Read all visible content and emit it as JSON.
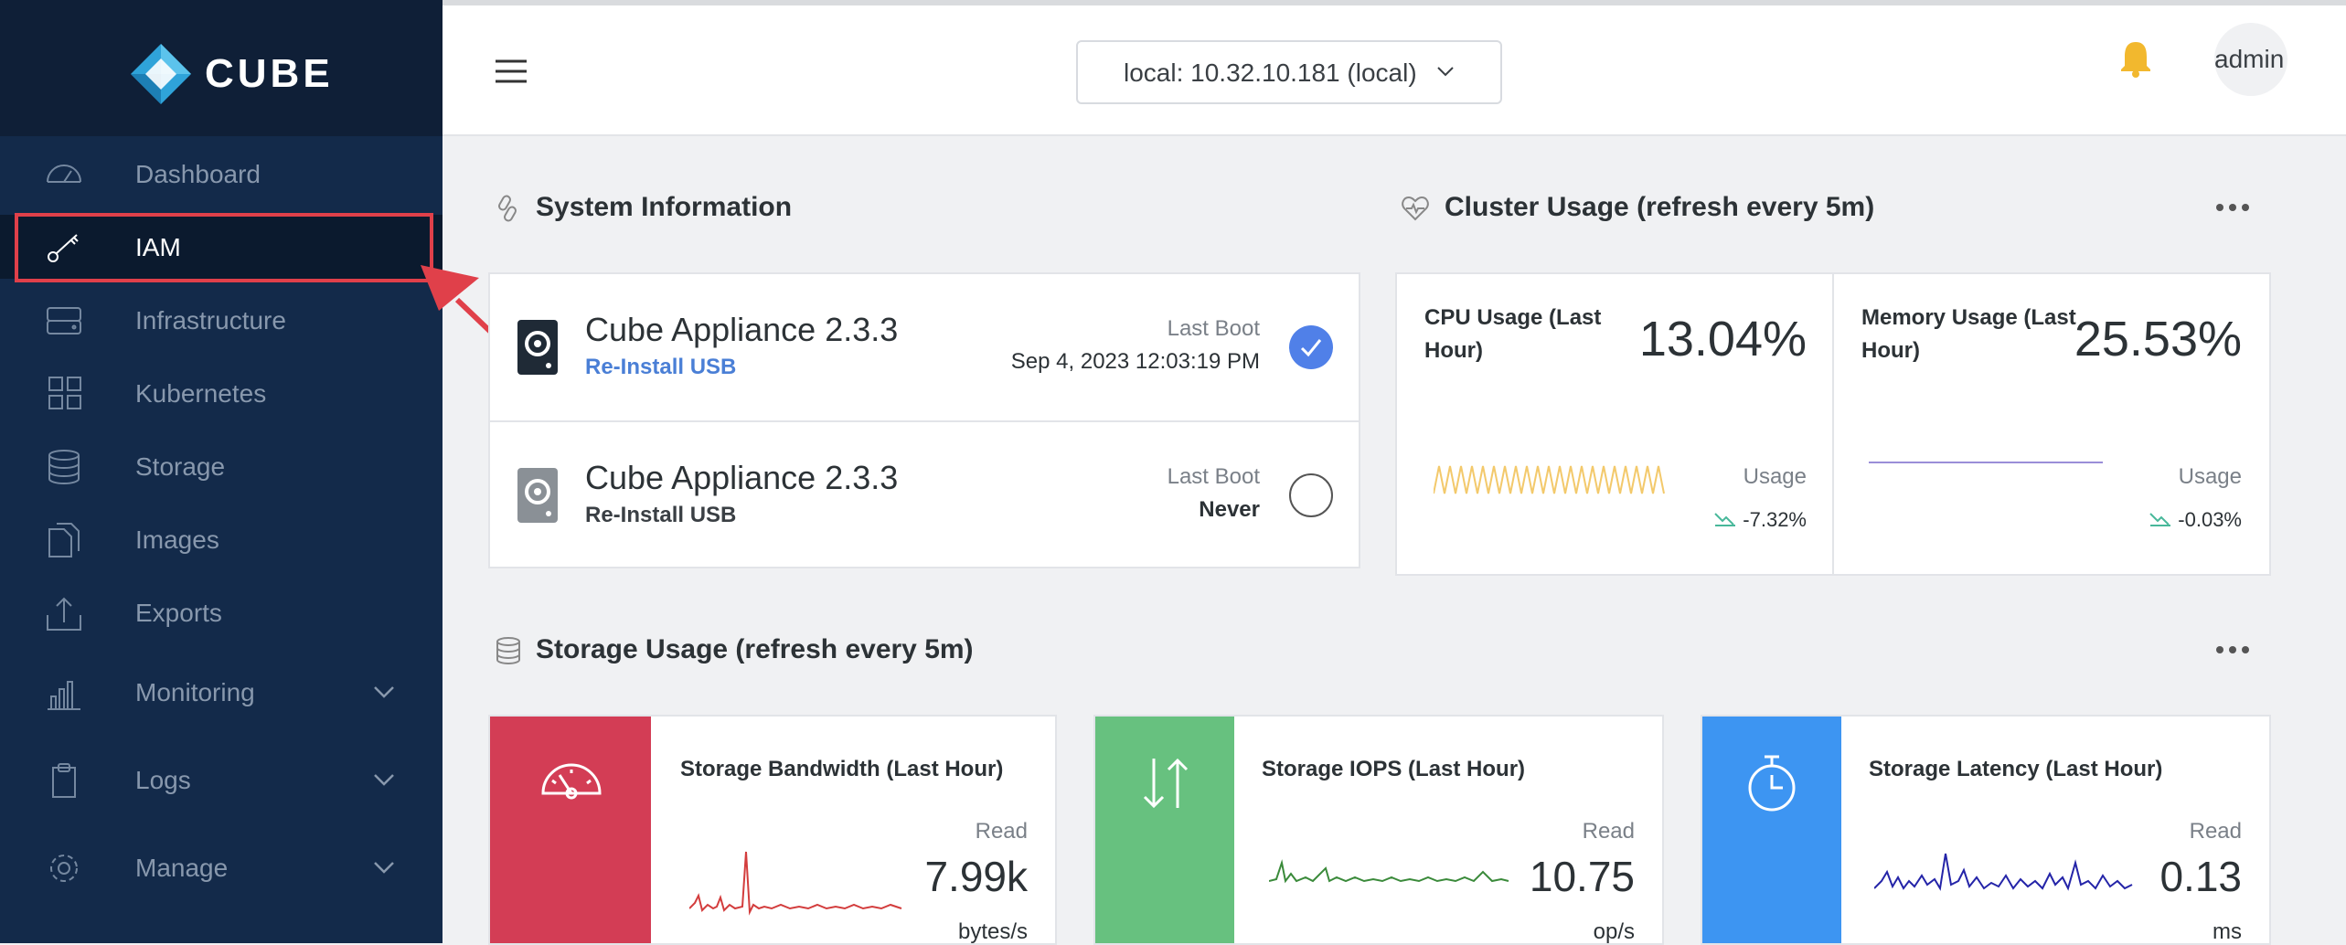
{
  "brand": {
    "name": "CUBE"
  },
  "sidebar": {
    "items": [
      {
        "label": "Dashboard",
        "icon": "speedometer-icon"
      },
      {
        "label": "IAM",
        "icon": "key-icon",
        "active": true
      },
      {
        "label": "Infrastructure",
        "icon": "server-icon"
      },
      {
        "label": "Kubernetes",
        "icon": "grid-icon"
      },
      {
        "label": "Storage",
        "icon": "database-icon"
      },
      {
        "label": "Images",
        "icon": "files-icon"
      },
      {
        "label": "Exports",
        "icon": "upload-icon"
      },
      {
        "label": "Monitoring",
        "icon": "bar-chart-icon",
        "expandable": true
      },
      {
        "label": "Logs",
        "icon": "clipboard-icon",
        "expandable": true
      },
      {
        "label": "Manage",
        "icon": "gear-icon",
        "expandable": true
      }
    ]
  },
  "header": {
    "server_selector": "local: 10.32.10.181 (local)",
    "user": "admin"
  },
  "system_information": {
    "title": "System Information",
    "boots": [
      {
        "name": "Cube Appliance 2.3.3",
        "action": "Re-Install USB",
        "last_boot_label": "Last Boot",
        "last_boot": "Sep 4, 2023 12:03:19 PM",
        "selected": true
      },
      {
        "name": "Cube Appliance 2.3.3",
        "action": "Re-Install USB",
        "last_boot_label": "Last Boot",
        "last_boot": "Never",
        "selected": false
      }
    ]
  },
  "cluster_usage": {
    "title": "Cluster Usage (refresh every 5m)",
    "cards": [
      {
        "title": "CPU Usage (Last Hour)",
        "value": "13.04%",
        "label": "Usage",
        "delta": "-7.32%",
        "color": "#f3c96b"
      },
      {
        "title": "Memory Usage (Last Hour)",
        "value": "25.53%",
        "label": "Usage",
        "delta": "-0.03%",
        "color": "#9a8ed8"
      }
    ]
  },
  "storage_usage": {
    "title": "Storage Usage (refresh every 5m)",
    "cards": [
      {
        "title": "Storage Bandwidth (Last Hour)",
        "read_label": "Read",
        "value": "7.99k",
        "unit": "bytes/s",
        "accent": "#d33d55",
        "line_color": "#d33d3d",
        "icon": "gauge-icon"
      },
      {
        "title": "Storage IOPS (Last Hour)",
        "read_label": "Read",
        "value": "10.75",
        "unit": "op/s",
        "accent": "#67c17f",
        "line_color": "#3a8a3a",
        "icon": "arrows-updown-icon"
      },
      {
        "title": "Storage Latency (Last Hour)",
        "read_label": "Read",
        "value": "0.13",
        "unit": "ms",
        "accent": "#3d95f2",
        "line_color": "#2424a8",
        "icon": "stopwatch-icon"
      }
    ]
  },
  "colors": {
    "sidebar": "#132a4a",
    "link": "#4a7fd6",
    "radio_checked": "#5080e8",
    "bell": "#f2b82e",
    "trend": "#48b89a"
  }
}
